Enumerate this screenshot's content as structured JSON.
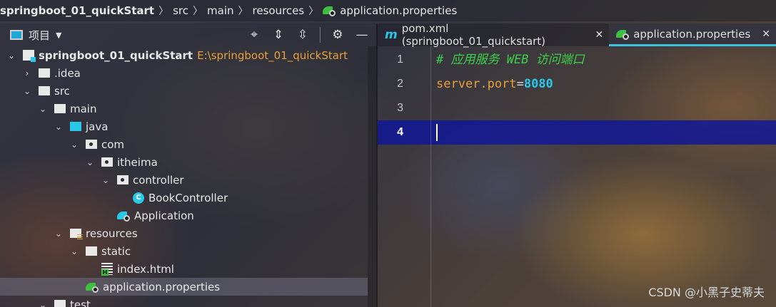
{
  "breadcrumb": {
    "items": [
      "springboot_01_quickStart",
      "src",
      "main",
      "resources",
      "application.properties"
    ]
  },
  "project_panel": {
    "title": "项目",
    "tools": [
      "crosshair-icon",
      "expand-all-icon",
      "collapse-all-icon",
      "gear-icon",
      "minimize-icon"
    ],
    "tree": [
      {
        "label": "springboot_01_quickStart",
        "path": "E:\\springboot_01_quickStart"
      },
      {
        "label": ".idea"
      },
      {
        "label": "src"
      },
      {
        "label": "main"
      },
      {
        "label": "java"
      },
      {
        "label": "com"
      },
      {
        "label": "itheima"
      },
      {
        "label": "controller"
      },
      {
        "label": "BookController"
      },
      {
        "label": "Application"
      },
      {
        "label": "resources"
      },
      {
        "label": "static"
      },
      {
        "label": "index.html"
      },
      {
        "label": "application.properties"
      },
      {
        "label": "test"
      }
    ]
  },
  "editor": {
    "tabs": [
      {
        "label": "pom.xml (springboot_01_quickstart)",
        "active": false
      },
      {
        "label": "application.properties",
        "active": true
      }
    ],
    "lines": [
      {
        "number": "1",
        "comment": "# 应用服务 WEB 访问端口"
      },
      {
        "number": "2",
        "key": "server.port",
        "eq": "=",
        "value": "8080"
      },
      {
        "number": "3"
      },
      {
        "number": "4"
      }
    ],
    "current_line": 4
  },
  "watermark": "CSDN @小黑子史蒂夫",
  "colors": {
    "accent": "#29c8e8",
    "comment": "#3bd04a",
    "key": "#e8a03a",
    "current_line": "#1018a0"
  }
}
